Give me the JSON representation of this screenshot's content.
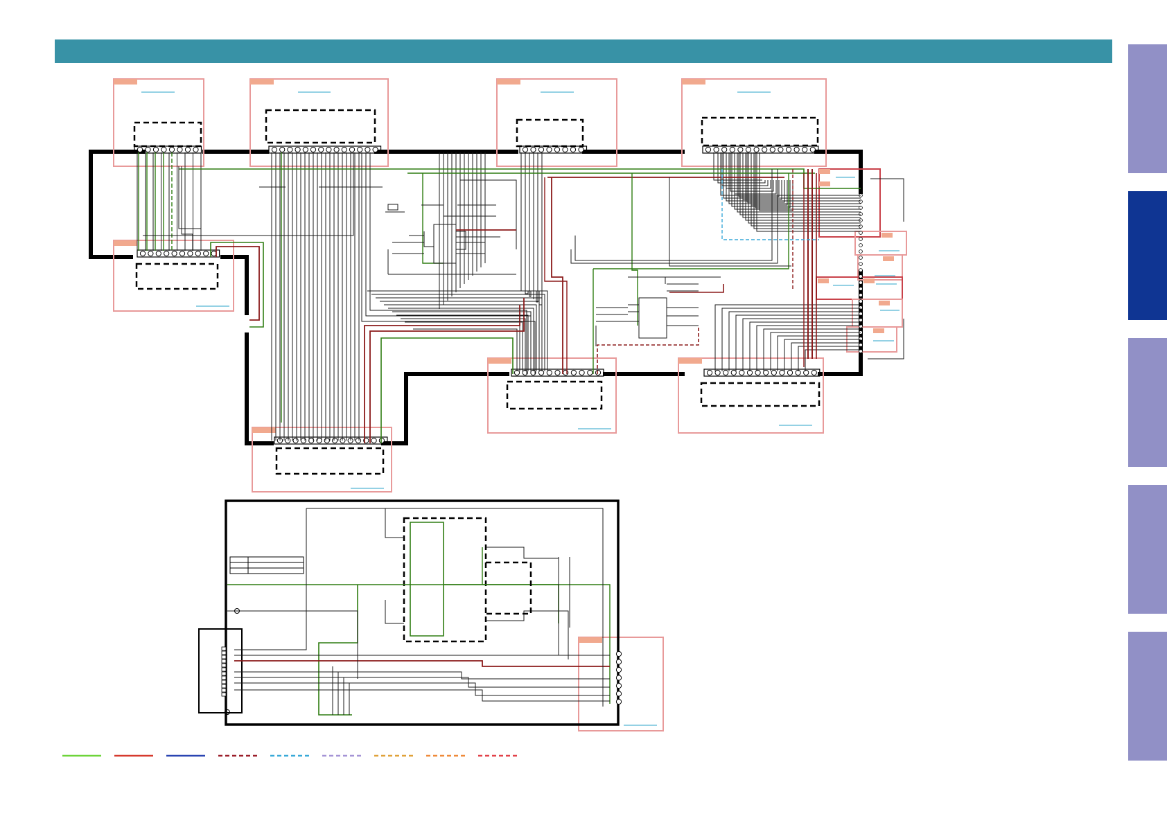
{
  "colors": {
    "header": "#3892a6",
    "tab_inactive": "#9190c6",
    "tab_active": "#0f3593",
    "board_outline": "#e89a9a",
    "board_label": "#f1a98e",
    "link": "#2aa3c9",
    "wire": "#1a1a1a",
    "wire_green": "#2f7d12",
    "wire_red": "#8b1a1a",
    "harness": "#000000"
  },
  "side_tabs": [
    {
      "id": "tab-1",
      "state": "inactive"
    },
    {
      "id": "tab-2",
      "state": "active"
    },
    {
      "id": "tab-3",
      "state": "inactive"
    },
    {
      "id": "tab-4",
      "state": "inactive"
    },
    {
      "id": "tab-5",
      "state": "inactive"
    }
  ],
  "legend": [
    {
      "color": "#6ed43a",
      "style": "solid"
    },
    {
      "color": "#d63a2e",
      "style": "solid"
    },
    {
      "color": "#2a45b2",
      "style": "solid"
    },
    {
      "color": "#9b1f2a",
      "style": "dashed"
    },
    {
      "color": "#39a9d8",
      "style": "dashed"
    },
    {
      "color": "#a594d6",
      "style": "dashed"
    },
    {
      "color": "#e0a23a",
      "style": "dashed"
    },
    {
      "color": "#ef8a3a",
      "style": "dashed"
    },
    {
      "color": "#e2424a",
      "style": "dashed"
    }
  ]
}
